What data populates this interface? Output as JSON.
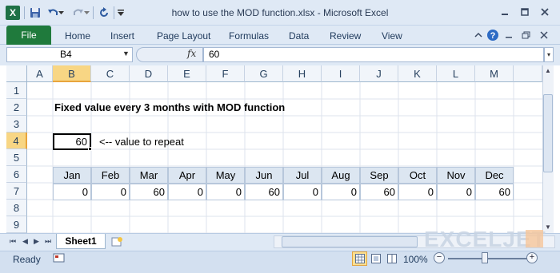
{
  "window": {
    "title": "how to use the MOD function.xlsx - Microsoft Excel",
    "app_icon_text": "X",
    "qat_icons": [
      "save-icon",
      "undo-icon",
      "undo-dropdown-icon",
      "redo-icon",
      "redo-dropdown-icon",
      "refresh-icon",
      "customize-qat-icon"
    ],
    "controls": [
      "minimize-icon",
      "maximize-icon",
      "close-icon"
    ]
  },
  "ribbon": {
    "file_label": "File",
    "tabs": [
      "Home",
      "Insert",
      "Page Layout",
      "Formulas",
      "Data",
      "Review",
      "View"
    ],
    "right_icons": [
      "ribbon-collapse-icon",
      "help-icon",
      "restore-icon",
      "workbook-close-icon"
    ]
  },
  "formula_bar": {
    "name_box": "B4",
    "fx_label": "fx",
    "formula_value": "60"
  },
  "sheet": {
    "columns": [
      "A",
      "B",
      "C",
      "D",
      "E",
      "F",
      "G",
      "H",
      "I",
      "J",
      "K",
      "L",
      "M"
    ],
    "selected_column": "B",
    "rows": [
      "1",
      "2",
      "3",
      "4",
      "5",
      "6",
      "7",
      "8",
      "9"
    ],
    "selected_row": "4",
    "title_text": "Fixed value every 3 months with MOD function",
    "b4_value": "60",
    "note_text": "<-- value to repeat",
    "months": [
      "Jan",
      "Feb",
      "Mar",
      "Apr",
      "May",
      "Jun",
      "Jul",
      "Aug",
      "Sep",
      "Oct",
      "Nov",
      "Dec"
    ],
    "values": [
      "0",
      "0",
      "60",
      "0",
      "0",
      "60",
      "0",
      "0",
      "60",
      "0",
      "0",
      "60"
    ],
    "header_fill": "#dce6f1",
    "border_color": "#b7c7db"
  },
  "tabs_row": {
    "sheet_name": "Sheet1",
    "watermark": "EXCELJET"
  },
  "status": {
    "ready": "Ready",
    "zoom": "100%",
    "zoom_out": "−",
    "zoom_in": "+"
  }
}
